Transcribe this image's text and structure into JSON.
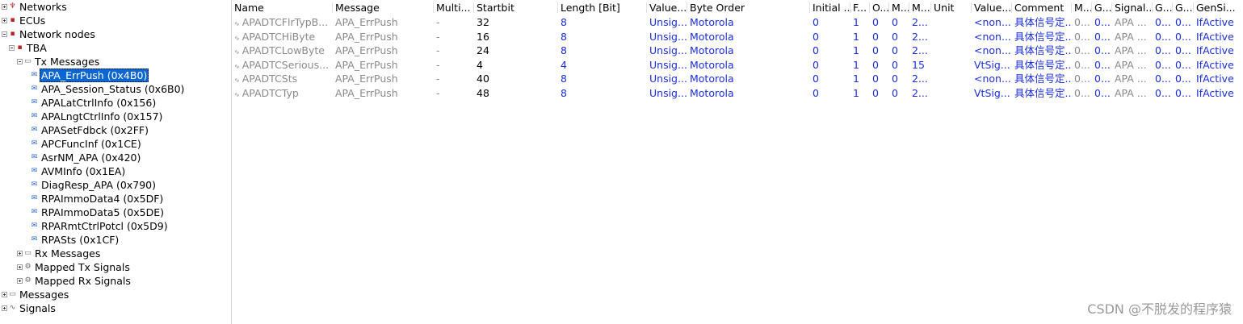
{
  "tree": {
    "networks": "Networks",
    "ecus": "ECUs",
    "network_nodes": "Network nodes",
    "tba": "TBA",
    "tx_messages": "Tx Messages",
    "tx_items": [
      "APA_ErrPush (0x4B0)",
      "APA_Session_Status (0x6B0)",
      "APALatCtrlInfo (0x156)",
      "APALngtCtrlInfo (0x157)",
      "APASetFdbck (0x2FF)",
      "APCFuncInf (0x1CE)",
      "AsrNM_APA (0x420)",
      "AVMInfo (0x1EA)",
      "DiagResp_APA (0x790)",
      "RPAImmoData4 (0x5DF)",
      "RPAImmoData5 (0x5DE)",
      "RPARmtCtrlPotcl (0x5D9)",
      "RPASts (0x1CF)"
    ],
    "rx_messages": "Rx Messages",
    "mapped_tx": "Mapped Tx Signals",
    "mapped_rx": "Mapped Rx Signals",
    "messages": "Messages",
    "signals": "Signals"
  },
  "table": {
    "headers": [
      "Name",
      "Message",
      "Multi...",
      "Startbit",
      "Length [Bit]",
      "Value...",
      "Byte Order",
      "Initial ...",
      "F...",
      "O...",
      "M...",
      "M...",
      "Unit",
      "Value...",
      "Comment",
      "M...",
      "G...",
      "Signal...",
      "G...",
      "G...",
      "GenSi..."
    ],
    "rows": [
      [
        "APADTCFlrTypB...",
        "APA_ErrPush",
        "-",
        "32",
        "8",
        "Unsig...",
        "Motorola",
        "0",
        "1",
        "0",
        "0",
        "2...",
        "",
        "<non...",
        "具体信号定...",
        "0...",
        "0...",
        "APA ...",
        "0...",
        "0...",
        "IfActive"
      ],
      [
        "APADTCHiByte",
        "APA_ErrPush",
        "-",
        "16",
        "8",
        "Unsig...",
        "Motorola",
        "0",
        "1",
        "0",
        "0",
        "2...",
        "",
        "<non...",
        "具体信号定...",
        "0...",
        "0...",
        "APA ...",
        "0...",
        "0...",
        "IfActive"
      ],
      [
        "APADTCLowByte",
        "APA_ErrPush",
        "-",
        "24",
        "8",
        "Unsig...",
        "Motorola",
        "0",
        "1",
        "0",
        "0",
        "2...",
        "",
        "<non...",
        "具体信号定...",
        "0...",
        "0...",
        "APA ...",
        "0...",
        "0...",
        "IfActive"
      ],
      [
        "APADTCSerious...",
        "APA_ErrPush",
        "-",
        "4",
        "4",
        "Unsig...",
        "Motorola",
        "0",
        "1",
        "0",
        "0",
        "15",
        "",
        "VtSig...",
        "具体信号定...",
        "0...",
        "0...",
        "APA ...",
        "0...",
        "0...",
        "IfActive"
      ],
      [
        "APADTCSts",
        "APA_ErrPush",
        "-",
        "40",
        "8",
        "Unsig...",
        "Motorola",
        "0",
        "1",
        "0",
        "0",
        "2...",
        "",
        "<non...",
        "具体信号定...",
        "0...",
        "0...",
        "APA ...",
        "0...",
        "0...",
        "IfActive"
      ],
      [
        "APADTCTyp",
        "APA_ErrPush",
        "-",
        "48",
        "8",
        "Unsig...",
        "Motorola",
        "0",
        "1",
        "0",
        "0",
        "2...",
        "",
        "VtSig...",
        "具体信号定...",
        "0...",
        "0...",
        "APA ...",
        "0...",
        "0...",
        "IfActive"
      ]
    ]
  },
  "watermark": "CSDN @不脱发的程序猿",
  "colors": {
    "selection": "#0a66d0",
    "value_blue": "#1a2ed8",
    "muted_gray": "#8a8a8a"
  }
}
